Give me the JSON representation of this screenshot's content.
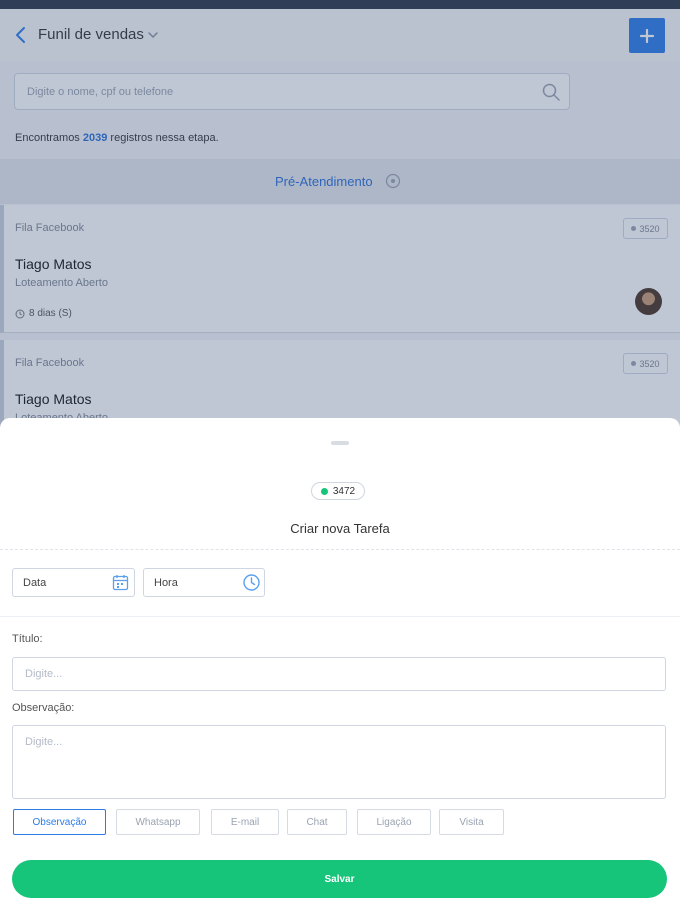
{
  "header": {
    "title": "Funil de vendas",
    "add_label": "+"
  },
  "search": {
    "placeholder": "Digite o nome, cpf ou telefone"
  },
  "results": {
    "prefix": "Encontramos",
    "count": "2039",
    "suffix": "registros nessa etapa."
  },
  "stage": {
    "label": "Pré-Atendimento"
  },
  "cards": [
    {
      "source": "Fila Facebook",
      "id": "3520",
      "name": "Tiago Matos",
      "subtitle": "Loteamento Aberto",
      "time": "8 dias (S)"
    },
    {
      "source": "Fila Facebook",
      "id": "3520",
      "name": "Tiago Matos",
      "subtitle": "Loteamento Aberto"
    }
  ],
  "task_sheet": {
    "badge": "3472",
    "title": "Criar nova Tarefa",
    "date_label": "Data",
    "hora_label": "Hora",
    "titulo_label": "Título:",
    "titulo_placeholder": "Digite...",
    "obs_label": "Observação:",
    "obs_placeholder": "Digite...",
    "types": [
      "Observação",
      "Whatsapp",
      "E-mail",
      "Chat",
      "Ligação",
      "Visita"
    ],
    "active_type": "Observação",
    "save_label": "Salvar"
  },
  "colors": {
    "primary": "#2b7ce9",
    "success": "#16c47a",
    "link": "#2b6fd6"
  },
  "icons": {
    "back": "chevron-left-icon",
    "dropdown": "chevron-down-icon",
    "add": "plus-icon",
    "search": "search-icon",
    "info": "info-icon",
    "time": "clock-icon",
    "calendar": "calendar-icon"
  }
}
